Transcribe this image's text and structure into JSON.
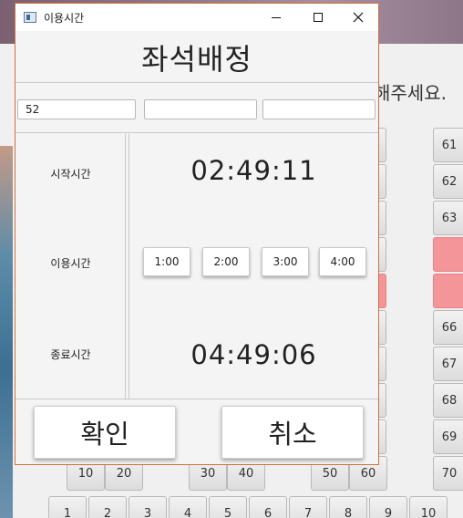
{
  "background": {
    "instruction": "해주세요.",
    "seats_right": [
      "61",
      "62",
      "63",
      "",
      "",
      "66",
      "67",
      "68",
      "69",
      "70"
    ],
    "seats_row_tens": [
      "10",
      "20",
      "30",
      "40",
      "50",
      "60"
    ],
    "seats_bottom": [
      "1",
      "2",
      "3",
      "4",
      "5",
      "6",
      "7",
      "8",
      "9",
      "10"
    ],
    "pink_color": "#f4959a"
  },
  "dialog": {
    "title": "이용시간",
    "header": "좌석배정",
    "fields": [
      "52",
      "",
      ""
    ],
    "labels": {
      "start": "시작시간",
      "use": "이용시간",
      "end": "종료시간"
    },
    "start_time": "02:49:11",
    "end_time": "04:49:06",
    "durations": [
      "1:00",
      "2:00",
      "3:00",
      "4:00"
    ],
    "confirm": "확인",
    "cancel": "취소",
    "accent_border": "#d0703c"
  }
}
